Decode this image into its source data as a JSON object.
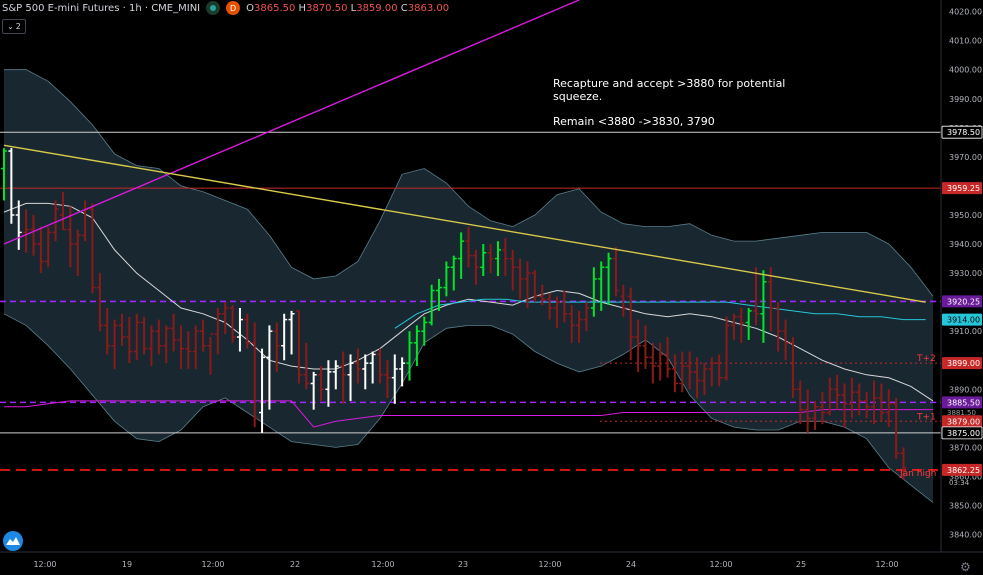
{
  "header": {
    "title": "S&P 500 E-mini Futures · 1h · CME_MINI",
    "badge": "D",
    "o_label": "O",
    "o_value": "3865.50",
    "h_label": "H",
    "h_value": "3870.50",
    "l_label": "L",
    "l_value": "3859.00",
    "c_label": "C",
    "c_value": "3863.00",
    "collapse_count": "2"
  },
  "annotation": {
    "line1": "Recapture and accept >3880 for potential squeeze.",
    "line2": "Remain <3880 ->3830, 3790"
  },
  "colors": {
    "background": "#000000",
    "up_candle": "#00e626",
    "down_candle": "#8b1a1a",
    "neutral_candle": "#ffffff",
    "band_fill": "#1b2b35",
    "band_line": "#5b7f8c",
    "magenta": "#d81bdf",
    "trendline": "#d8c94a",
    "purple_dash": "#9c27ff",
    "red_dash": "#ff1a1a",
    "teal": "#26c6da"
  },
  "chart_data": {
    "type": "line",
    "title": "S&P 500 E-mini Futures · 1h · CME_MINI",
    "yrange": [
      3834,
      4024
    ],
    "y_ticks": [
      4020,
      4010,
      4000,
      3990,
      3980,
      3970,
      3960,
      3950,
      3940,
      3930,
      3920,
      3910,
      3900,
      3890,
      3880,
      3870,
      3860,
      3850,
      3840
    ],
    "x_ticks": [
      "12:00",
      "19",
      "12:00",
      "22",
      "12:00",
      "23",
      "12:00",
      "24",
      "12:00",
      "25",
      "12:00"
    ],
    "ohlc": {
      "open": 3865.5,
      "high": 3870.5,
      "low": 3859.0,
      "close": 3863.0
    },
    "price_labels": [
      {
        "text": "3978.50",
        "value": 3978.5,
        "color": "#ffffff",
        "bg": "#000000",
        "border": "#ffffff"
      },
      {
        "text": "3959.25",
        "value": 3959.25,
        "color": "#ffffff",
        "bg": "#c62828"
      },
      {
        "text": "3920.25",
        "value": 3920.25,
        "color": "#ffffff",
        "bg": "#6a1b9a"
      },
      {
        "text": "3914.00",
        "value": 3914.0,
        "color": "#000000",
        "bg": "#26c6da"
      },
      {
        "text": "3899.00",
        "value": 3899.0,
        "color": "#ffffff",
        "bg": "#c62828"
      },
      {
        "text": "3885.50",
        "value": 3885.5,
        "color": "#ffffff",
        "bg": "#6a1b9a"
      },
      {
        "text": "3879.00",
        "value": 3879.0,
        "color": "#ffffff",
        "bg": "#c62828"
      },
      {
        "text": "3875.00",
        "value": 3875.0,
        "color": "#ffffff",
        "bg": "#000000",
        "border": "#ffffff"
      },
      {
        "text": "3862.25",
        "value": 3862.25,
        "color": "#ffffff",
        "bg": "#c62828"
      }
    ],
    "overlapped_labels": [
      "3881.50",
      "03:34"
    ],
    "horizontal_levels": [
      {
        "value": 3978.5,
        "style": "solid",
        "color": "#cfcfcf"
      },
      {
        "value": 3959.25,
        "style": "solid",
        "color": "#c62828"
      },
      {
        "value": 3920.25,
        "style": "dashed",
        "color": "#9c27ff"
      },
      {
        "value": 3885.5,
        "style": "dashed",
        "color": "#9c27ff"
      },
      {
        "value": 3875.0,
        "style": "solid",
        "color": "#cfcfcf"
      },
      {
        "value": 3862.25,
        "style": "dashed",
        "color": "#ff1a1a"
      }
    ],
    "targets": [
      {
        "label": "T+2",
        "value": 3899.0
      },
      {
        "label": "T+1",
        "value": 3879.0
      },
      {
        "label": "Jan high",
        "value": 3859.5
      }
    ],
    "trendlines": [
      {
        "name": "",
        "color": "#d81bdf",
        "x": [
          0,
          78
        ],
        "y": [
          3940,
          4024
        ]
      },
      {
        "name": "",
        "color": "#d8c94a",
        "x": [
          0,
          125
        ],
        "y": [
          3974,
          3920
        ]
      }
    ],
    "series": [
      {
        "name": "",
        "x": [
          0,
          3,
          6,
          9,
          12,
          15,
          18,
          21,
          24,
          27,
          30,
          33,
          36,
          39,
          42,
          45,
          48,
          51,
          54,
          57,
          60,
          63,
          66,
          69,
          72,
          75,
          78,
          81,
          84,
          87,
          90,
          93,
          96,
          99,
          102,
          105,
          108,
          111,
          114,
          117,
          120,
          123,
          126
        ],
        "values": [
          3951,
          3954,
          3954,
          3953,
          3949,
          3938,
          3930,
          3924,
          3918,
          3916,
          3913,
          3907,
          3900,
          3898,
          3897,
          3897,
          3900,
          3904,
          3910,
          3916,
          3919,
          3921,
          3920,
          3919,
          3922,
          3924,
          3923,
          3920,
          3918,
          3916,
          3915,
          3916,
          3915,
          3913,
          3911,
          3908,
          3904,
          3900,
          3897,
          3895,
          3894,
          3891,
          3886
        ]
      },
      {
        "name": "",
        "x": [
          0,
          3,
          6,
          9,
          12,
          15,
          18,
          21,
          24,
          27,
          30,
          33,
          36,
          39,
          42,
          45,
          48,
          51,
          54,
          57,
          60,
          63,
          66,
          69,
          72,
          75,
          78,
          81,
          84,
          87,
          90,
          93,
          96,
          99,
          102,
          105,
          108,
          111,
          114,
          117,
          120,
          123,
          126
        ],
        "values": [
          3884,
          3884,
          3885,
          3886,
          3886,
          3886,
          3886,
          3886,
          3886,
          3886,
          3886,
          3886,
          3886,
          3886,
          3877,
          3879,
          3880,
          3881,
          3881,
          3881,
          3881,
          3881,
          3881,
          3881,
          3881,
          3881,
          3881,
          3881,
          3882,
          3882,
          3882,
          3882,
          3882,
          3882,
          3882,
          3882,
          3882,
          3883,
          3883,
          3883,
          3883,
          3883,
          3883
        ]
      },
      {
        "name": "",
        "x": [
          53,
          56,
          59,
          62,
          65,
          68,
          71,
          74,
          77,
          80,
          83,
          86,
          89,
          92,
          95,
          98,
          101,
          104,
          107,
          110,
          113,
          116,
          119,
          122,
          125
        ],
        "values": [
          3911,
          3916,
          3919,
          3920,
          3921,
          3921,
          3920,
          3920,
          3920,
          3920,
          3920,
          3920,
          3920,
          3920,
          3920,
          3920,
          3919,
          3918,
          3917,
          3916,
          3916,
          3915,
          3915,
          3914,
          3914
        ]
      }
    ],
    "band_upper": {
      "x": [
        0,
        3,
        6,
        9,
        12,
        15,
        18,
        21,
        24,
        27,
        30,
        33,
        36,
        39,
        42,
        45,
        48,
        51,
        54,
        57,
        60,
        63,
        66,
        69,
        72,
        75,
        78,
        81,
        84,
        87,
        90,
        93,
        96,
        99,
        102,
        105,
        108,
        111,
        114,
        117,
        120,
        123,
        126
      ],
      "values": [
        4000,
        4000,
        3996,
        3989,
        3981,
        3971,
        3967,
        3966,
        3960,
        3958,
        3955,
        3952,
        3943,
        3932,
        3928,
        3929,
        3934,
        3948,
        3964,
        3966,
        3961,
        3953,
        3948,
        3946,
        3950,
        3957,
        3959,
        3951,
        3947,
        3946,
        3946,
        3947,
        3943,
        3941,
        3941,
        3942,
        3943,
        3944,
        3944,
        3944,
        3940,
        3932,
        3922
      ]
    },
    "band_lower": {
      "x": [
        0,
        3,
        6,
        9,
        12,
        15,
        18,
        21,
        24,
        27,
        30,
        33,
        36,
        39,
        42,
        45,
        48,
        51,
        54,
        57,
        60,
        63,
        66,
        69,
        72,
        75,
        78,
        81,
        84,
        87,
        90,
        93,
        96,
        99,
        102,
        105,
        108,
        111,
        114,
        117,
        120,
        123,
        126
      ],
      "values": [
        3916,
        3912,
        3905,
        3897,
        3888,
        3879,
        3873,
        3872,
        3876,
        3884,
        3887,
        3882,
        3877,
        3872,
        3871,
        3870,
        3871,
        3880,
        3892,
        3906,
        3911,
        3912,
        3912,
        3909,
        3903,
        3899,
        3896,
        3898,
        3902,
        3907,
        3901,
        3888,
        3880,
        3877,
        3876,
        3876,
        3879,
        3879,
        3877,
        3873,
        3863,
        3857,
        3851
      ]
    },
    "candles_ohlc": [
      [
        3966,
        3973,
        3955,
        3972
      ],
      [
        3972,
        3973,
        3947,
        3950
      ],
      [
        3950,
        3955,
        3938,
        3944
      ],
      [
        3944,
        3952,
        3937,
        3945
      ],
      [
        3945,
        3950,
        3936,
        3940
      ],
      [
        3940,
        3946,
        3930,
        3934
      ],
      [
        3934,
        3946,
        3932,
        3944
      ],
      [
        3944,
        3955,
        3941,
        3952
      ],
      [
        3950,
        3958,
        3945,
        3945
      ],
      [
        3945,
        3953,
        3932,
        3940
      ],
      [
        3940,
        3945,
        3929,
        3943
      ],
      [
        3943,
        3955,
        3941,
        3952
      ],
      [
        3952,
        3954,
        3923,
        3925
      ],
      [
        3925,
        3930,
        3910,
        3912
      ],
      [
        3912,
        3918,
        3902,
        3905
      ],
      [
        3905,
        3914,
        3897,
        3912
      ],
      [
        3912,
        3916,
        3905,
        3908
      ],
      [
        3908,
        3915,
        3899,
        3903
      ],
      [
        3903,
        3916,
        3900,
        3913
      ],
      [
        3913,
        3915,
        3902,
        3904
      ],
      [
        3904,
        3912,
        3898,
        3910
      ],
      [
        3910,
        3914,
        3902,
        3905
      ],
      [
        3905,
        3912,
        3899,
        3911
      ],
      [
        3911,
        3916,
        3903,
        3907
      ],
      [
        3907,
        3912,
        3897,
        3904
      ],
      [
        3904,
        3910,
        3897,
        3903
      ],
      [
        3903,
        3912,
        3897,
        3910
      ],
      [
        3910,
        3914,
        3903,
        3905
      ],
      [
        3905,
        3908,
        3895,
        3909
      ],
      [
        3909,
        3918,
        3902,
        3916
      ],
      [
        3916,
        3920,
        3909,
        3918
      ],
      [
        3918,
        3919,
        3906,
        3908
      ],
      [
        3908,
        3918,
        3903,
        3914
      ],
      [
        3914,
        3916,
        3904,
        3906
      ],
      [
        3906,
        3913,
        3877,
        3880
      ],
      [
        3882,
        3904,
        3875,
        3901
      ],
      [
        3901,
        3912,
        3883,
        3910
      ],
      [
        3910,
        3913,
        3896,
        3905
      ],
      [
        3905,
        3916,
        3900,
        3914
      ],
      [
        3914,
        3917,
        3902,
        3916
      ],
      [
        3917,
        3917,
        3892,
        3895
      ],
      [
        3895,
        3906,
        3890,
        3892
      ],
      [
        3892,
        3896,
        3883,
        3895
      ],
      [
        3895,
        3898,
        3886,
        3890
      ],
      [
        3890,
        3900,
        3884,
        3896
      ],
      [
        3896,
        3900,
        3890,
        3898
      ],
      [
        3898,
        3903,
        3885,
        3895
      ],
      [
        3895,
        3902,
        3886,
        3899
      ],
      [
        3899,
        3904,
        3892,
        3897
      ],
      [
        3897,
        3902,
        3890,
        3899
      ],
      [
        3899,
        3903,
        3892,
        3902
      ],
      [
        3902,
        3904,
        3892,
        3895
      ],
      [
        3895,
        3900,
        3887,
        3894
      ],
      [
        3894,
        3902,
        3885,
        3897
      ],
      [
        3897,
        3901,
        3891,
        3899
      ],
      [
        3899,
        3910,
        3893,
        3906
      ],
      [
        3906,
        3912,
        3898,
        3910
      ],
      [
        3910,
        3915,
        3905,
        3913
      ],
      [
        3913,
        3926,
        3912,
        3924
      ],
      [
        3924,
        3928,
        3917,
        3925
      ],
      [
        3925,
        3934,
        3922,
        3932
      ],
      [
        3932,
        3936,
        3924,
        3935
      ],
      [
        3935,
        3944,
        3928,
        3941
      ],
      [
        3941,
        3946,
        3932,
        3936
      ],
      [
        3936,
        3938,
        3926,
        3932
      ],
      [
        3932,
        3940,
        3929,
        3937
      ],
      [
        3937,
        3940,
        3930,
        3935
      ],
      [
        3935,
        3941,
        3929,
        3938
      ],
      [
        3938,
        3942,
        3929,
        3935
      ],
      [
        3935,
        3938,
        3924,
        3932
      ],
      [
        3932,
        3935,
        3921,
        3928
      ],
      [
        3928,
        3934,
        3918,
        3930
      ],
      [
        3930,
        3931,
        3920,
        3922
      ],
      [
        3922,
        3926,
        3919,
        3921
      ],
      [
        3921,
        3923,
        3914,
        3918
      ],
      [
        3918,
        3922,
        3911,
        3920
      ],
      [
        3920,
        3924,
        3913,
        3916
      ],
      [
        3916,
        3919,
        3906,
        3912
      ],
      [
        3912,
        3917,
        3906,
        3914
      ],
      [
        3914,
        3920,
        3910,
        3918
      ],
      [
        3918,
        3932,
        3915,
        3928
      ],
      [
        3928,
        3934,
        3917,
        3932
      ],
      [
        3932,
        3937,
        3919,
        3935
      ],
      [
        3935,
        3939,
        3922,
        3924
      ],
      [
        3922,
        3926,
        3915,
        3918
      ],
      [
        3922,
        3925,
        3900,
        3908
      ],
      [
        3908,
        3914,
        3896,
        3905
      ],
      [
        3905,
        3912,
        3897,
        3901
      ],
      [
        3901,
        3906,
        3892,
        3898
      ],
      [
        3898,
        3906,
        3893,
        3902
      ],
      [
        3902,
        3908,
        3894,
        3897
      ],
      [
        3897,
        3902,
        3889,
        3892
      ],
      [
        3892,
        3903,
        3889,
        3898
      ],
      [
        3898,
        3903,
        3890,
        3896
      ],
      [
        3896,
        3901,
        3887,
        3893
      ],
      [
        3893,
        3899,
        3888,
        3897
      ],
      [
        3897,
        3901,
        3891,
        3899
      ],
      [
        3899,
        3902,
        3891,
        3894
      ],
      [
        3894,
        3915,
        3893,
        3912
      ],
      [
        3912,
        3916,
        3907,
        3915
      ],
      [
        3915,
        3918,
        3906,
        3913
      ],
      [
        3913,
        3918,
        3907,
        3917
      ],
      [
        3917,
        3932,
        3912,
        3916
      ],
      [
        3916,
        3931,
        3906,
        3927
      ],
      [
        3927,
        3932,
        3910,
        3918
      ],
      [
        3918,
        3920,
        3903,
        3910
      ],
      [
        3910,
        3914,
        3900,
        3906
      ],
      [
        3906,
        3908,
        3887,
        3890
      ],
      [
        3890,
        3893,
        3878,
        3883
      ],
      [
        3883,
        3890,
        3875,
        3880
      ],
      [
        3880,
        3886,
        3876,
        3884
      ],
      [
        3884,
        3889,
        3878,
        3882
      ],
      [
        3882,
        3894,
        3881,
        3890
      ],
      [
        3890,
        3895,
        3883,
        3888
      ],
      [
        3888,
        3892,
        3877,
        3885
      ],
      [
        3885,
        3894,
        3880,
        3889
      ],
      [
        3889,
        3892,
        3881,
        3886
      ],
      [
        3886,
        3889,
        3880,
        3884
      ],
      [
        3884,
        3893,
        3878,
        3887
      ],
      [
        3887,
        3892,
        3879,
        3882
      ],
      [
        3882,
        3890,
        3877,
        3885
      ],
      [
        3885,
        3887,
        3866,
        3868
      ],
      [
        3868,
        3870,
        3859,
        3863
      ]
    ]
  }
}
